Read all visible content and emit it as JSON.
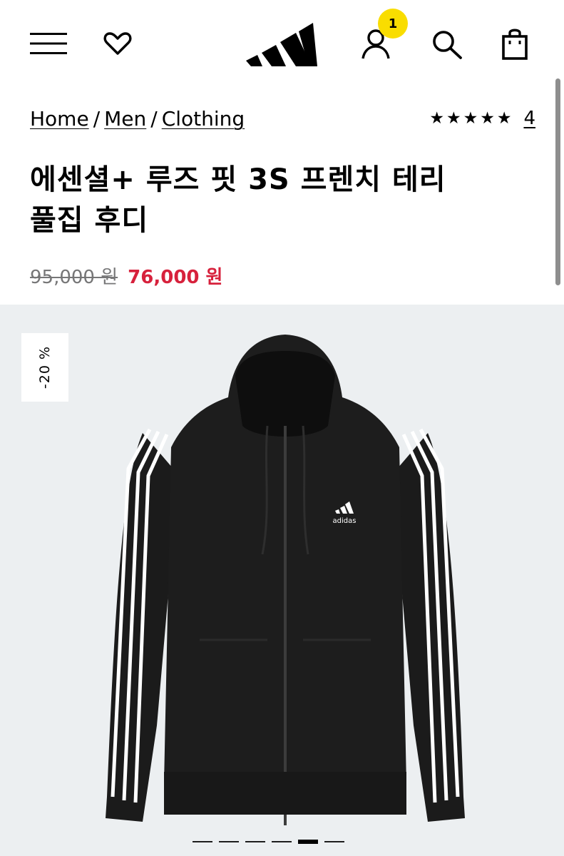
{
  "header": {
    "icons": [
      "menu-icon",
      "heart-icon",
      "adidas-logo",
      "account-icon",
      "search-icon",
      "shopping-bag-icon"
    ],
    "cart_badge": "1",
    "badge_color": "#f9dd00"
  },
  "breadcrumb": {
    "items": [
      "Home",
      "Men",
      "Clothing"
    ],
    "separator": "/"
  },
  "rating": {
    "stars": "★★★★★",
    "review_count": "4"
  },
  "product": {
    "title_line1": "에센셜+ 루즈 핏 3S 프렌치 테리",
    "title_line2": "풀집 후디",
    "original_price": "95,000 원",
    "sale_price": "76,000 원",
    "sale_color": "#d7213c",
    "discount_badge": "-20 %"
  },
  "gallery": {
    "background": "#eceff1",
    "slide_count": 6,
    "active_slide": 5
  }
}
